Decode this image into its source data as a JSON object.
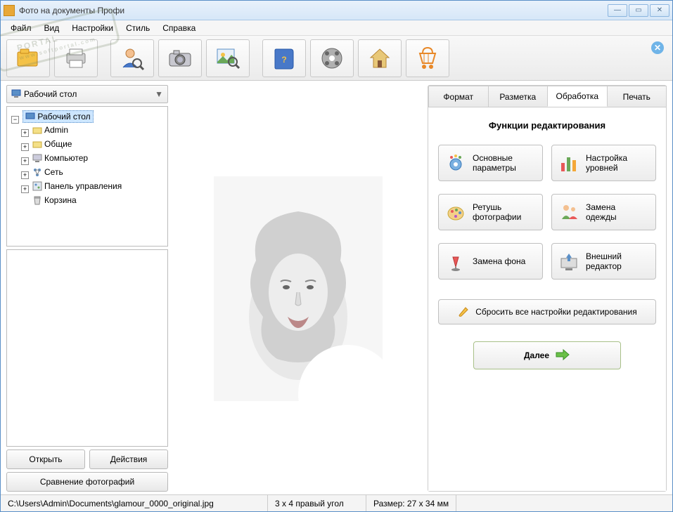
{
  "window": {
    "title": "Фото на документы Профи"
  },
  "menu": {
    "file": "Файл",
    "view": "Вид",
    "settings": "Настройки",
    "style": "Стиль",
    "help": "Справка"
  },
  "toolbar": {
    "icons": [
      "folder-open-icon",
      "printer-icon",
      "person-search-icon",
      "camera-icon",
      "image-zoom-icon",
      "help-book-icon",
      "film-reel-icon",
      "home-icon",
      "cart-icon"
    ]
  },
  "left": {
    "location": "Рабочий стол",
    "tree": {
      "root": "Рабочий стол",
      "nodes": [
        {
          "label": "Admin",
          "icon": "folder"
        },
        {
          "label": "Общие",
          "icon": "folder"
        },
        {
          "label": "Компьютер",
          "icon": "computer"
        },
        {
          "label": "Сеть",
          "icon": "network"
        },
        {
          "label": "Панель управления",
          "icon": "controlpanel"
        },
        {
          "label": "Корзина",
          "icon": "trash"
        }
      ]
    },
    "open": "Открыть",
    "actions": "Действия",
    "compare": "Сравнение фотографий"
  },
  "tabs": {
    "format": "Формат",
    "layout": "Разметка",
    "processing": "Обработка",
    "print": "Печать",
    "active": "processing"
  },
  "processing": {
    "heading": "Функции редактирования",
    "basic": "Основные параметры",
    "levels": "Настройка уровней",
    "retouch": "Ретушь фотографии",
    "clothes": "Замена одежды",
    "background": "Замена фона",
    "external": "Внешний редактор",
    "reset": "Сбросить все настройки редактирования",
    "next": "Далее"
  },
  "status": {
    "path": "C:\\Users\\Admin\\Documents\\glamour_0000_original.jpg",
    "corner": "3 x 4 правый угол",
    "size": "Размер: 27 x 34 мм"
  },
  "watermark": {
    "text": "PORTAL",
    "sub": "www.softportal.com"
  }
}
